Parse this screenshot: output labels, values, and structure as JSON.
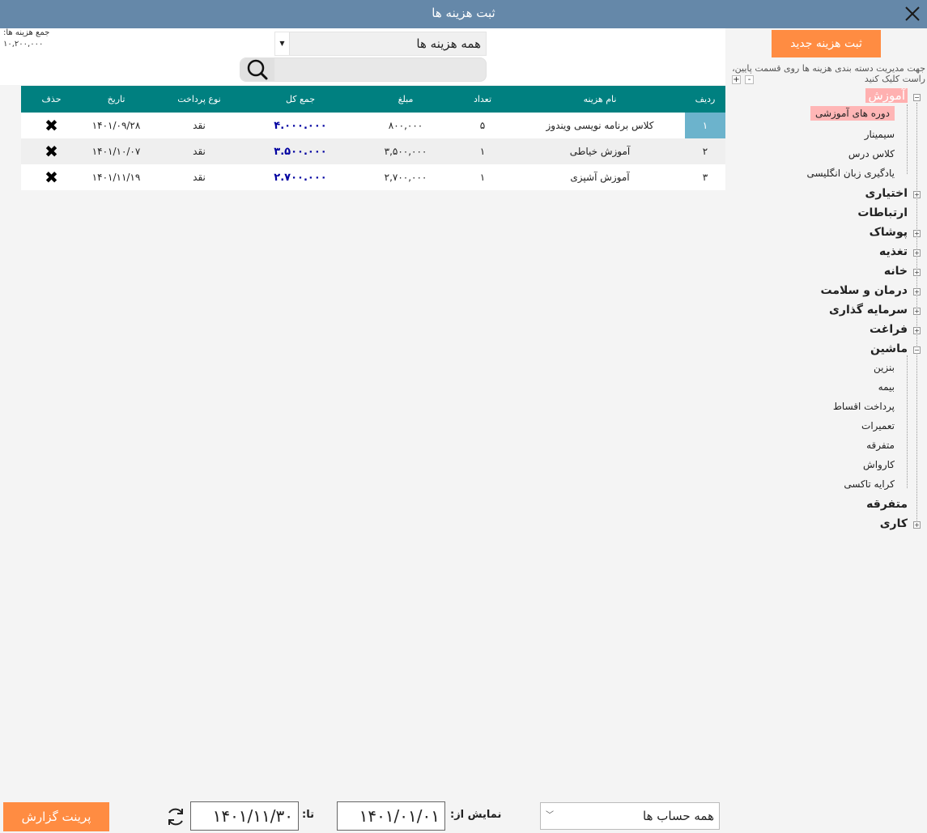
{
  "window": {
    "title": "ثبت هزینه ها",
    "close_icon": "close-icon"
  },
  "summary": {
    "label": "جمع هزینه ها:",
    "value": "۱۰,۲۰۰,۰۰۰"
  },
  "filter": {
    "selected": "همه هزینه ها"
  },
  "search": {
    "value": ""
  },
  "table": {
    "headers": {
      "row": "ردیف",
      "name": "نام هزینه",
      "qty": "تعداد",
      "price": "مبلغ",
      "total": "جمع کل",
      "pay_type": "نوع پرداخت",
      "date": "تاریخ",
      "delete": "حذف"
    },
    "rows": [
      {
        "row": "۱",
        "name": "کلاس برنامه نویسی ویندوز",
        "qty": "۵",
        "price": "۸۰۰,۰۰۰",
        "total": "۴.۰۰۰.۰۰۰",
        "pay_type": "نقد",
        "date": "۱۴۰۱/۰۹/۲۸",
        "delete": "✖"
      },
      {
        "row": "۲",
        "name": "آموزش خیاطی",
        "qty": "۱",
        "price": "۳,۵۰۰,۰۰۰",
        "total": "۳.۵۰۰.۰۰۰",
        "pay_type": "نقد",
        "date": "۱۴۰۱/۱۰/۰۷",
        "delete": "✖"
      },
      {
        "row": "۳",
        "name": "آموزش آشپزی",
        "qty": "۱",
        "price": "۲,۷۰۰,۰۰۰",
        "total": "۲.۷۰۰.۰۰۰",
        "pay_type": "نقد",
        "date": "۱۴۰۱/۱۱/۱۹",
        "delete": "✖"
      }
    ]
  },
  "sidebar": {
    "new_button": "ثبت هزینه جدید",
    "hint": "جهت مدیریت دسته بندی هزینه ها روی قسمت پایین، راست کلیک کنید",
    "zoom_in": "+",
    "zoom_out": "-",
    "tree": {
      "education": {
        "label": "آموزش",
        "children": [
          "دوره های آموزشی",
          "سیمینار",
          "کلاس درس",
          "یادگیری زبان انگلیسی"
        ]
      },
      "optional": "اختیاری",
      "communications": "ارتباطات",
      "clothing": "پوشاک",
      "food": "تغذیه",
      "home": "خانه",
      "health": "درمان و سلامت",
      "investment": "سرمایه گذاری",
      "leisure": "فراغت",
      "car": {
        "label": "ماشین",
        "children": [
          "بنزین",
          "بیمه",
          "پرداخت اقساط",
          "تعمیرات",
          "متفرقه",
          "کارواش",
          "کرایه تاکسی"
        ]
      },
      "misc": "متفرقه",
      "work": "کاری"
    }
  },
  "footer": {
    "print_button": "پرینت گزارش",
    "to_label": "تا:",
    "to_date": "۱۴۰۱/۱۱/۳۰",
    "from_label": "نمایش از:",
    "from_date": "۱۴۰۱/۰۱/۰۱",
    "account_select": "همه حساب ها"
  }
}
